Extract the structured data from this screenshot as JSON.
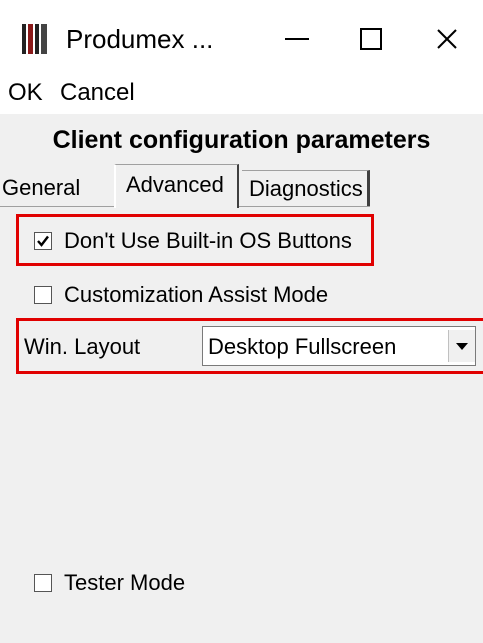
{
  "window": {
    "title": "Produmex ...",
    "controls": {
      "minimize": "—",
      "maximize": "☐",
      "close": "✕"
    },
    "icon": "app-icon"
  },
  "menu": {
    "ok": "OK",
    "cancel": "Cancel"
  },
  "form": {
    "title": "Client configuration parameters",
    "tabs": [
      {
        "label": "General",
        "selected": false
      },
      {
        "label": "Advanced",
        "selected": true
      },
      {
        "label": "Diagnostics",
        "selected": false
      }
    ],
    "options": {
      "builtin_buttons": {
        "label": "Don't Use Built-in OS Buttons",
        "checked": true
      },
      "assist_mode": {
        "label": "Customization Assist Mode",
        "checked": false
      },
      "tester_mode": {
        "label": "Tester Mode",
        "checked": false
      }
    },
    "win_layout": {
      "label": "Win. Layout",
      "value": "Desktop Fullscreen"
    }
  },
  "colors": {
    "highlight": "#e00000",
    "form_bg": "#f0f0f0"
  }
}
